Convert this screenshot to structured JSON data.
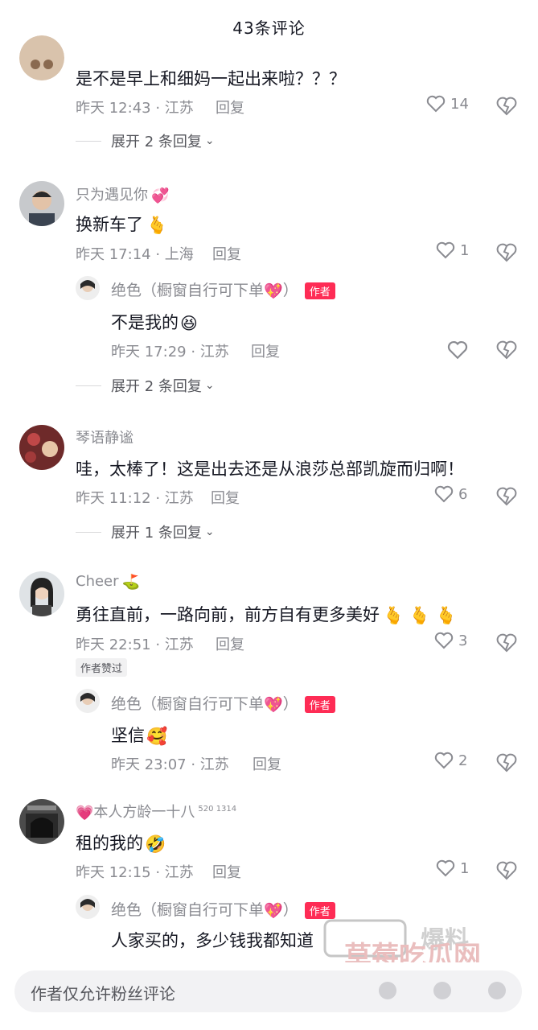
{
  "header": {
    "title": "43条评论"
  },
  "comments": [
    {
      "username": "",
      "text": "是不是早上和细妈一起出来啦？？？",
      "time": "昨天 12:43 · 江苏",
      "reply_label": "回复",
      "likes": "14",
      "expand": "展开 2 条回复"
    },
    {
      "username": "只为遇见你",
      "text": "换新车了",
      "time": "昨天 17:14 · 上海",
      "reply_label": "回复",
      "likes": "1",
      "reply": {
        "username": "绝色（橱窗自行可下单",
        "username_end": "）",
        "author_tag": "作者",
        "text": "不是我的",
        "time": "昨天 17:29 · 江苏",
        "reply_label": "回复"
      },
      "expand": "展开 2 条回复"
    },
    {
      "username": "琴语静谧",
      "text": "哇，太棒了！这是出去还是从浪莎总部凯旋而归啊！",
      "time": "昨天 11:12 · 江苏",
      "reply_label": "回复",
      "likes": "6",
      "expand": "展开 1 条回复"
    },
    {
      "username": "Cheer",
      "text": "勇往直前，一路向前，前方自有更多美好",
      "time": "昨天 22:51 · 江苏",
      "reply_label": "回复",
      "likes": "3",
      "badge": "作者赞过",
      "reply": {
        "username": "绝色（橱窗自行可下单",
        "username_end": "）",
        "author_tag": "作者",
        "text": "坚信",
        "time": "昨天 23:07 · 江苏",
        "reply_label": "回复",
        "likes": "2"
      }
    },
    {
      "username": "本人方龄一十八",
      "username_suffix": "520 1314",
      "text": "租的我的",
      "time": "昨天 12:15 · 江苏",
      "reply_label": "回复",
      "likes": "1",
      "reply": {
        "username": "绝色（橱窗自行可下单",
        "username_end": "）",
        "author_tag": "作者",
        "text": "人家买的，多少钱我都知道"
      }
    }
  ],
  "bottom": {
    "placeholder": "作者仅允许粉丝评论"
  },
  "watermark": {
    "text": "草莓吃瓜网",
    "url": "www.cmcgw.com"
  }
}
